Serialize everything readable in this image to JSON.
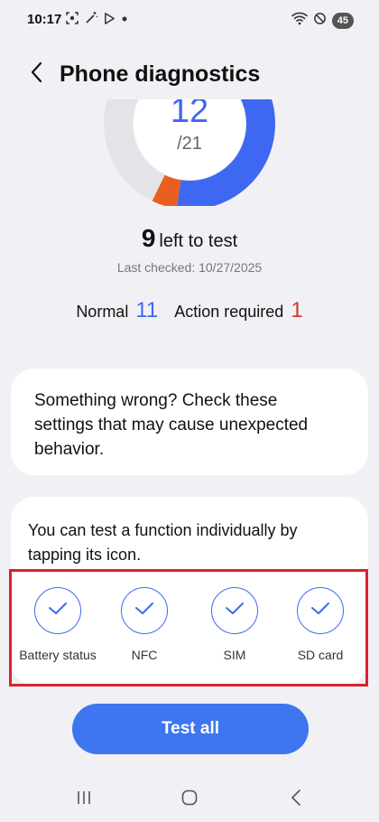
{
  "status_bar": {
    "time": "10:17",
    "battery": "45",
    "icons": [
      "screenshot-icon",
      "magic-wand-icon",
      "play-store-icon",
      "dot-icon",
      "wifi-icon",
      "do-not-disturb-icon"
    ]
  },
  "header": {
    "title": "Phone diagnostics",
    "back_icon": "chevron-left-icon"
  },
  "progress": {
    "tested_count": "12",
    "total_label": "/21",
    "tested": 12,
    "total": 21,
    "normal": 11,
    "action_required": 1,
    "colors": {
      "normal": "#3e68f2",
      "action": "#e8601f",
      "remaining": "#e4e4e8"
    }
  },
  "remaining": {
    "count": "9",
    "label": "left to test"
  },
  "last_checked": "Last checked: 10/27/2025",
  "summary": {
    "normal_label": "Normal",
    "normal_value": "11",
    "action_label": "Action required",
    "action_value": "1"
  },
  "cards": {
    "settings_message": "Something wrong? Check these settings that may cause unexpected behavior.",
    "individual_message": "You can test a function individually by tapping its icon."
  },
  "tests": [
    {
      "label": "Battery status",
      "icon": "check-icon"
    },
    {
      "label": "NFC",
      "icon": "check-icon"
    },
    {
      "label": "SIM",
      "icon": "check-icon"
    },
    {
      "label": "SD card",
      "icon": "check-icon"
    }
  ],
  "test_all_label": "Test all",
  "nav": {
    "recents_icon": "recents-icon",
    "home_icon": "home-icon",
    "back_icon": "back-icon"
  },
  "colors": {
    "accent": "#3e68f2",
    "button": "#3e76f0",
    "error": "#d7342b",
    "highlight": "#d9222e"
  }
}
